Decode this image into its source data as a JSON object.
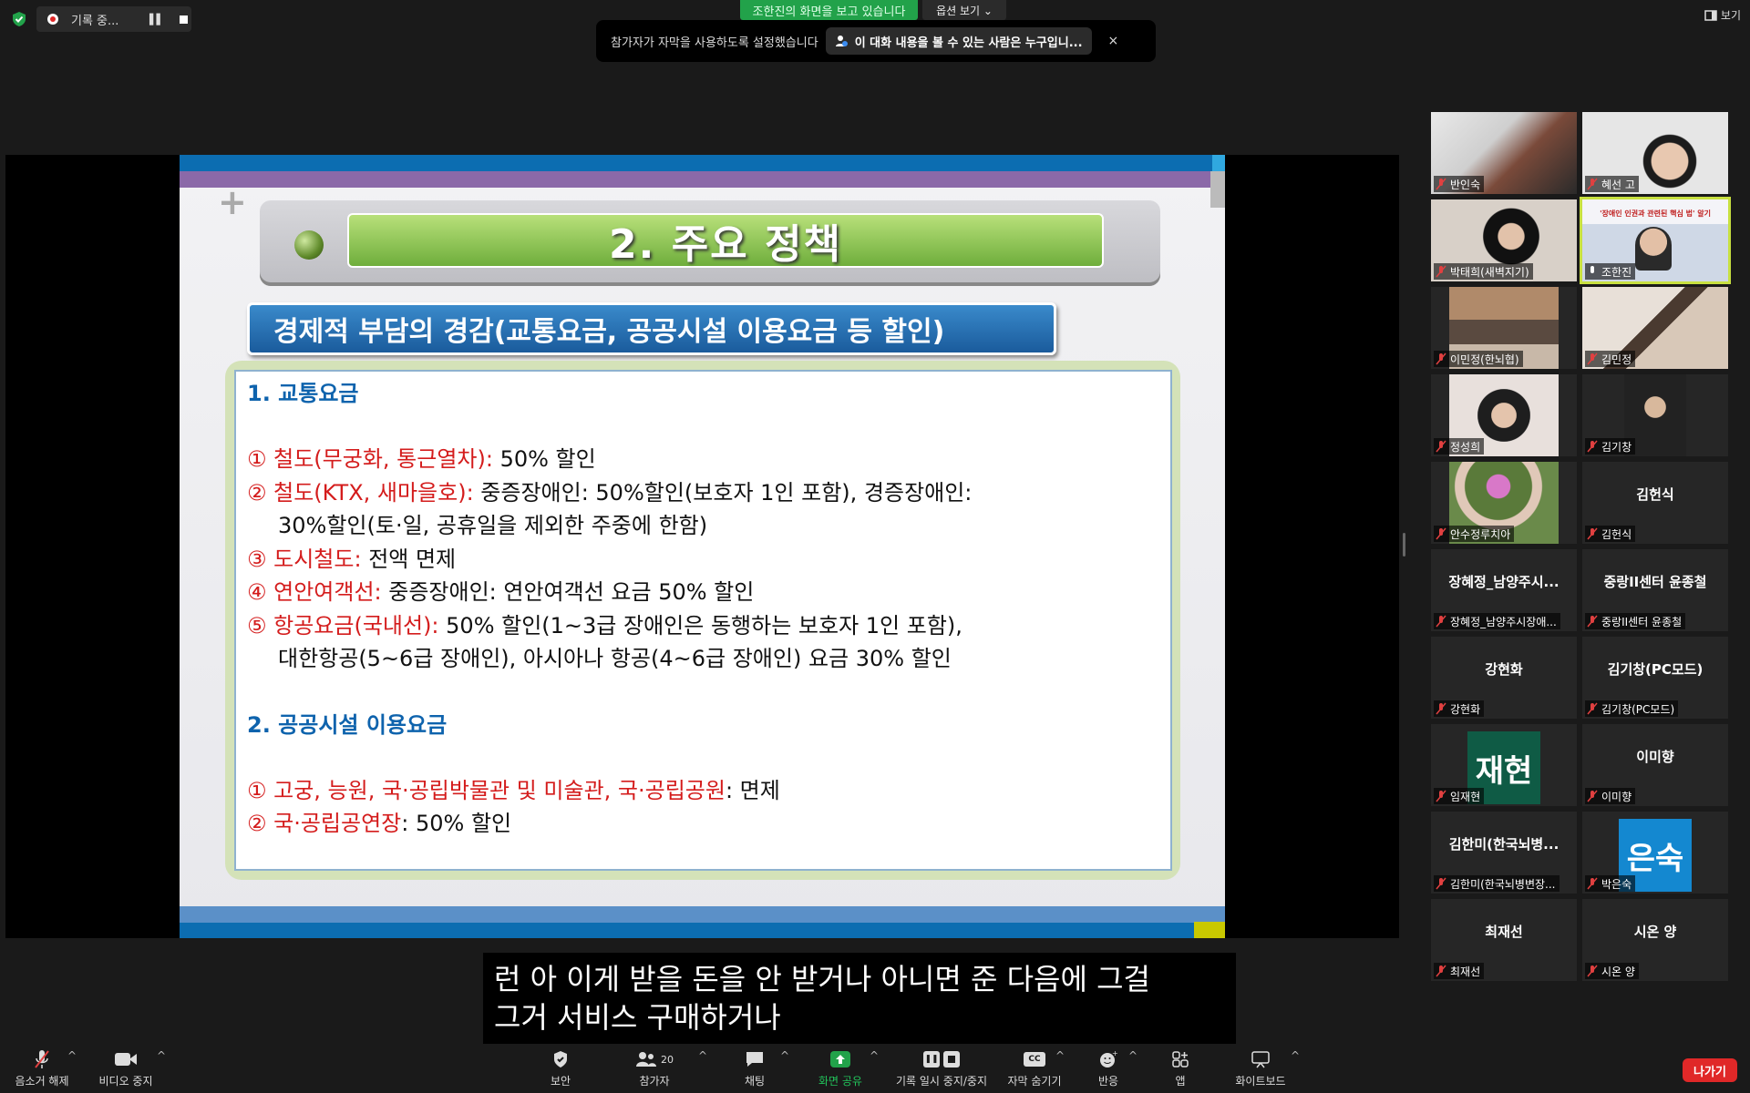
{
  "top": {
    "recording_label": "기록 중...",
    "viewing_badge": "조한진의 화면을 보고 있습니다",
    "view_options": "옵션 보기 ⌄",
    "caption_notice": "참가자가 자막을 사용하도록 설정했습니다",
    "who_can_see": "이 대화 내용을 볼 수 있는 사람은 누구입니...",
    "close": "×",
    "view_toggle": "보기"
  },
  "slide": {
    "title": "2. 주요 정책",
    "subtitle": "경제적 부담의 경감(교통요금, 공공시설 이용요금 등 할인)",
    "section1": "1. 교통요금",
    "items1": [
      {
        "red": "① 철도(무궁화, 통근열차):",
        "text": " 50% 할인"
      },
      {
        "red": "② 철도(KTX, 새마을호):",
        "text": " 중증장애인: 50%할인(보호자 1인 포함), 경증장애인:"
      },
      {
        "red": "",
        "text": "30%할인(토·일, 공휴일을 제외한 주중에 한함)"
      },
      {
        "red": "③ 도시철도:",
        "text": " 전액 면제"
      },
      {
        "red": "④ 연안여객선:",
        "text": " 중증장애인: 연안여객선 요금 50% 할인"
      },
      {
        "red": "⑤ 항공요금(국내선):",
        "text": " 50% 할인(1~3급 장애인은 동행하는 보호자 1인 포함),"
      },
      {
        "red": "",
        "text": "대한항공(5~6급 장애인), 아시아나 항공(4~6급 장애인) 요금 30% 할인"
      }
    ],
    "section2": "2. 공공시설 이용요금",
    "items2": [
      {
        "red": "① 고궁, 능원, 국·공립박물관 및 미술관, 국·공립공원",
        "text": ": 면제"
      },
      {
        "red": "② 국·공립공연장",
        "text": ": 50% 할인"
      }
    ]
  },
  "participants": [
    {
      "name": "반인숙",
      "display": ""
    },
    {
      "name": "혜선 고",
      "display": ""
    },
    {
      "name": "박태희(새벽지기)",
      "display": ""
    },
    {
      "name": "조한진",
      "display": ""
    },
    {
      "name": "이민정(한뇌협)",
      "display": ""
    },
    {
      "name": "김민정",
      "display": ""
    },
    {
      "name": "정성희",
      "display": ""
    },
    {
      "name": "김기창",
      "display": ""
    },
    {
      "name": "안수정루치아",
      "display": ""
    },
    {
      "name": "김헌식",
      "display": "김헌식"
    },
    {
      "name": "장혜정_남양주시장애...",
      "display": "장혜정_남양주시..."
    },
    {
      "name": "중랑II센터 윤종철",
      "display": "중랑II센터 윤종철"
    },
    {
      "name": "강현화",
      "display": "강현화"
    },
    {
      "name": "김기창(PC모드)",
      "display": "김기창(PC모드)"
    },
    {
      "name": "임재현",
      "display": "재현"
    },
    {
      "name": "이미향",
      "display": "이미향"
    },
    {
      "name": "김한미(한국뇌병변장...",
      "display": "김한미(한국뇌병..."
    },
    {
      "name": "박은숙",
      "display": "은숙"
    },
    {
      "name": "최재선",
      "display": "최재선"
    },
    {
      "name": "시온 양",
      "display": "시온 양"
    }
  ],
  "slide_thumb_text": "'장애인 인권과 관련된 핵심 법' 알기",
  "live_caption": {
    "line1": "런 아 이게 받을 돈을 안 받거나 아니면 준 다음에 그걸",
    "line2": "그거 서비스 구매하거나"
  },
  "toolbar": {
    "unmute": "음소거 해제",
    "stop_video": "비디오 중지",
    "security": "보안",
    "participants": "참가자",
    "participants_count": "20",
    "chat": "채팅",
    "share_screen": "화면 공유",
    "record_pause": "기록 일시 중지/중지",
    "hide_captions": "자막 숨기기",
    "reactions": "반응",
    "apps": "앱",
    "whiteboard": "화이트보드",
    "leave": "나가기"
  },
  "colors": {
    "accent_green": "#22a24a",
    "leave_red": "#e02828",
    "slide_blue": "#0c6db1",
    "slide_red_text": "#d41c1c",
    "avatar_green": "#0f5b45",
    "avatar_blue": "#1488d0"
  }
}
